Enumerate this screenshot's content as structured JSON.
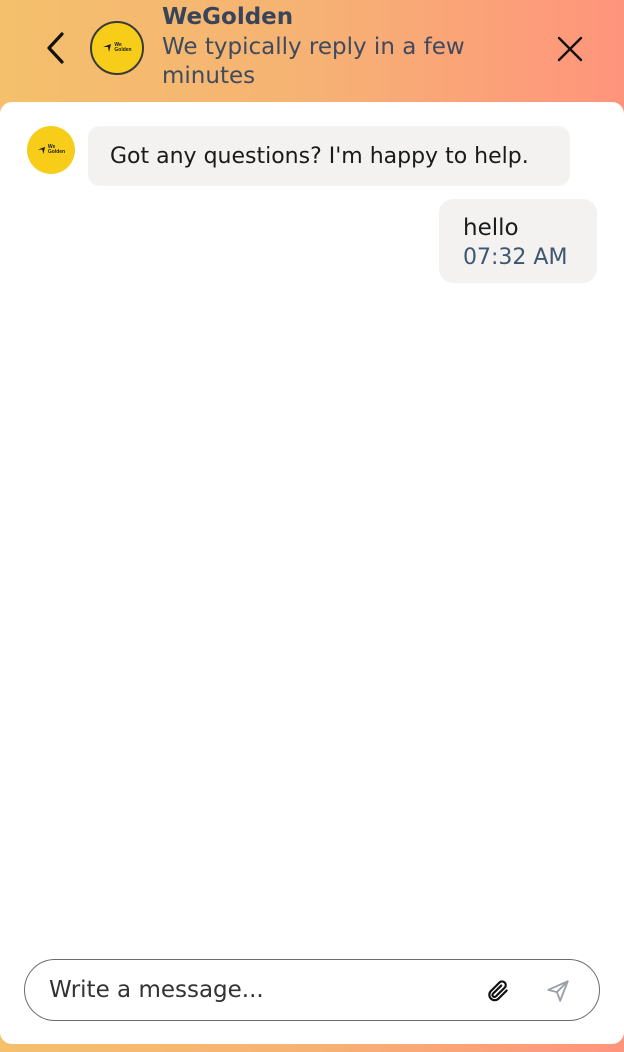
{
  "header": {
    "title": "WeGolden",
    "subtitle": "We typically reply in a few minutes",
    "brand_gradient": [
      "#f4c06c",
      "#ff947c"
    ],
    "back_icon": "chevron-left-icon",
    "close_icon": "close-icon"
  },
  "brand": {
    "logo_line1": "We",
    "logo_line2": "Golden",
    "logo_color": "#f7cd1a"
  },
  "messages": [
    {
      "from": "agent",
      "text": "Got any questions? I'm happy to help."
    },
    {
      "from": "user",
      "text": "hello",
      "time": "07:32 AM"
    }
  ],
  "composer": {
    "placeholder": "Write a message...",
    "value": "",
    "attach_icon": "paperclip-icon",
    "send_icon": "send-icon"
  }
}
